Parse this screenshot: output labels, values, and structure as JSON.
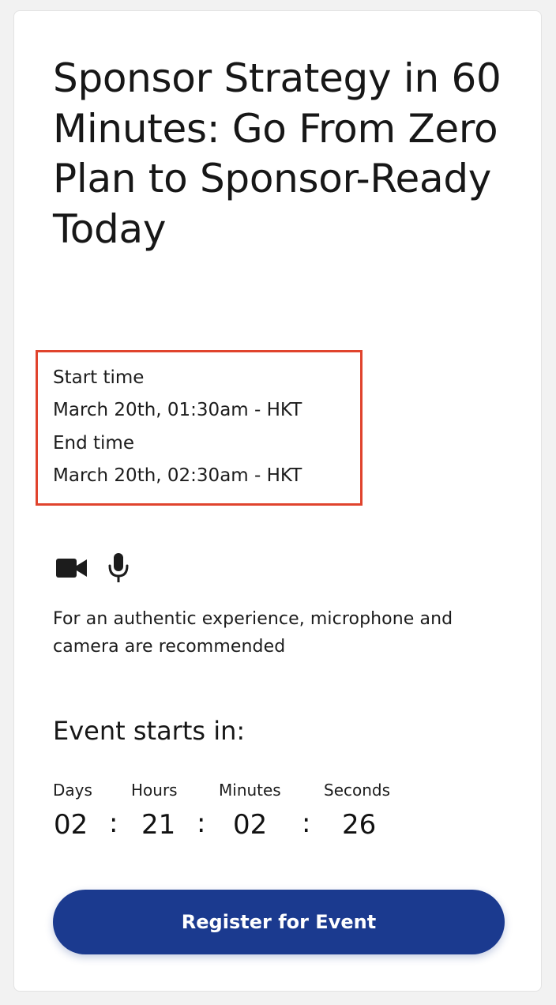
{
  "event": {
    "title": "Sponsor Strategy in 60 Minutes: Go From Zero Plan to Sponsor-Ready Today"
  },
  "schedule": {
    "start_label": "Start time",
    "start_value": "March 20th, 01:30am - HKT",
    "end_label": "End time",
    "end_value": "March 20th, 02:30am - HKT"
  },
  "icons": [
    "camera-icon",
    "microphone-icon"
  ],
  "recommendation": "For an authentic experience, microphone and camera are recommended",
  "countdown": {
    "heading": "Event starts in:",
    "separator": ":",
    "units": [
      {
        "label": "Days",
        "value": "02"
      },
      {
        "label": "Hours",
        "value": "21"
      },
      {
        "label": "Minutes",
        "value": "02"
      },
      {
        "label": "Seconds",
        "value": "26"
      }
    ]
  },
  "register_button": "Register for Event",
  "colors": {
    "accent": "#1b3a8f",
    "highlight_border": "#e0432d",
    "card_background": "#ffffff",
    "page_background": "#f2f2f2"
  }
}
